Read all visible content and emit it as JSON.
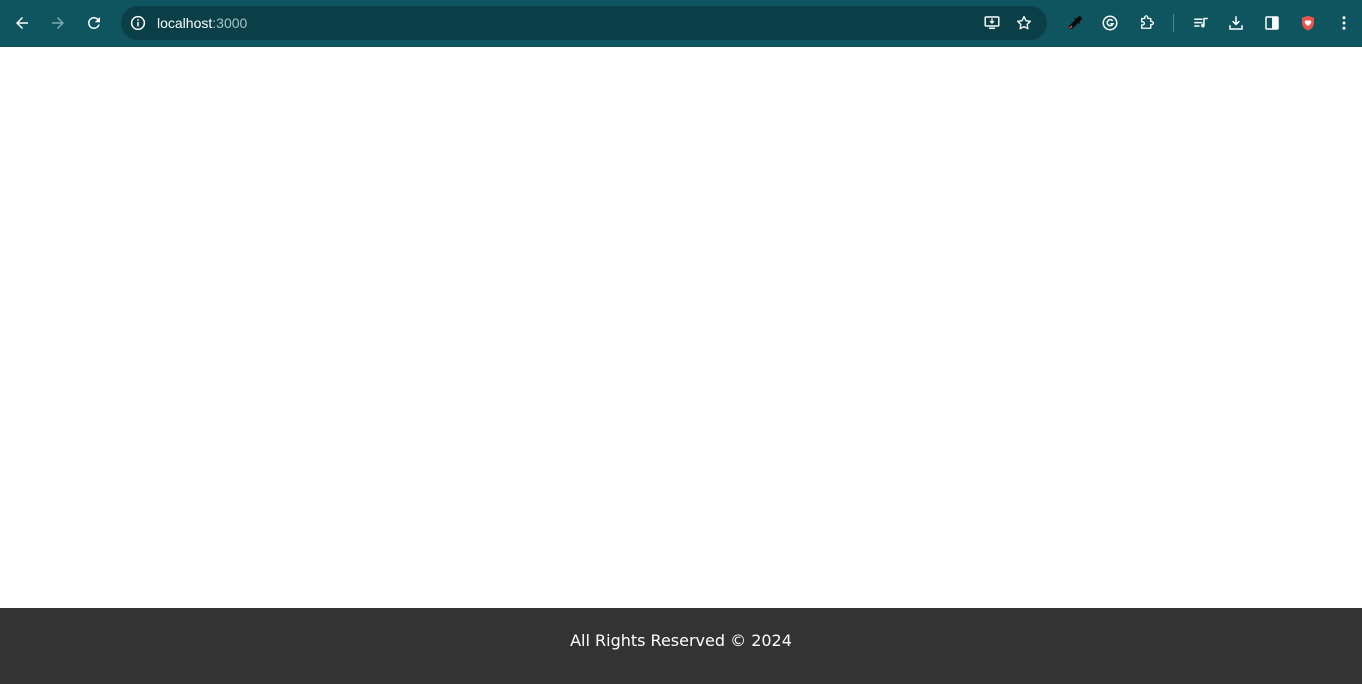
{
  "browser": {
    "url_host": "localhost",
    "url_port": ":3000",
    "toolbar_color": "#0f5560",
    "omnibox_color": "#0a3f47",
    "icons": {
      "back": "arrow-left-icon",
      "forward": "arrow-right-icon",
      "reload": "reload-icon",
      "site_info": "info-icon",
      "install_app": "install-app-icon",
      "bookmark": "star-icon",
      "eyedropper": "eyedropper-icon",
      "grammarly": "grammarly-icon",
      "extensions": "puzzle-icon",
      "media": "media-controls-icon",
      "downloads": "download-icon",
      "side_panel": "side-panel-icon",
      "shield": "shield-icon",
      "menu": "kebab-menu-icon"
    }
  },
  "footer": {
    "text": "All Rights Reserved © 2024",
    "background": "#333333"
  }
}
